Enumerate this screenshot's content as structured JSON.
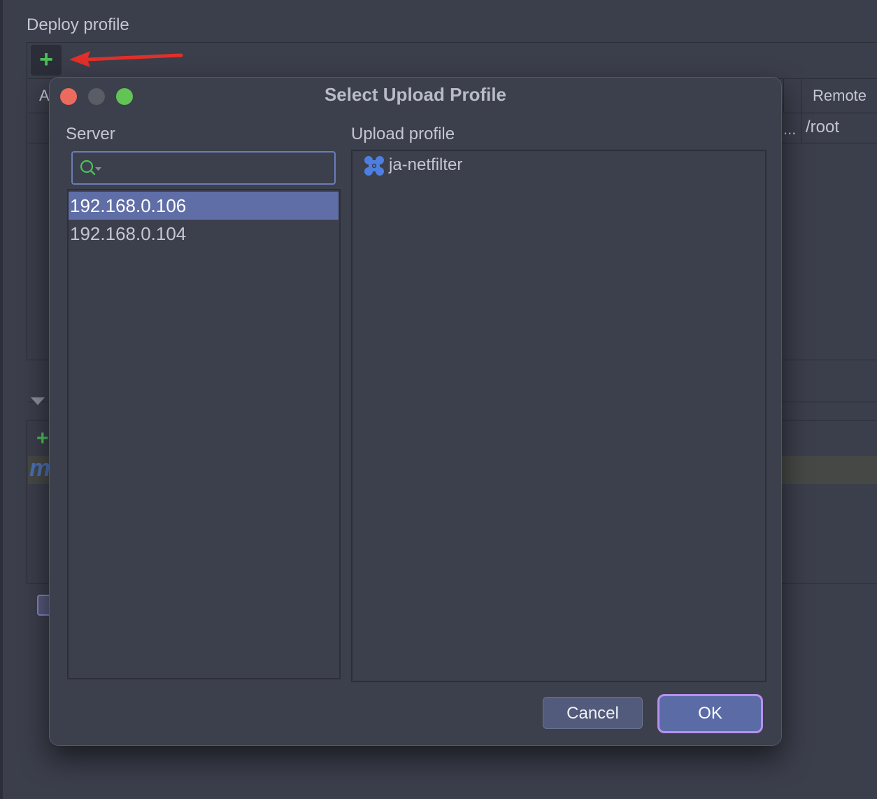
{
  "background": {
    "section_title": "Deploy profile",
    "add_glyph": "+",
    "table": {
      "first_column_fragment": "A",
      "remote_header": "Remote",
      "remote_value": "/root",
      "truncated": "..."
    },
    "lower_fragment": "m"
  },
  "dialog": {
    "title": "Select Upload Profile",
    "server_label": "Server",
    "upload_profile_label": "Upload profile",
    "search": {
      "value": "",
      "placeholder": ""
    },
    "servers": [
      {
        "label": "192.168.0.106",
        "selected": true
      },
      {
        "label": "192.168.0.104",
        "selected": false
      }
    ],
    "profiles": [
      {
        "label": "ja-netfilter",
        "icon": "upload-profile-icon"
      }
    ],
    "buttons": {
      "cancel": "Cancel",
      "ok": "OK"
    }
  },
  "colors": {
    "accent": "#5f6ea6",
    "focus_ring": "#b890ee",
    "add_green": "#4cc05a",
    "annotation_arrow": "#e0302a"
  }
}
